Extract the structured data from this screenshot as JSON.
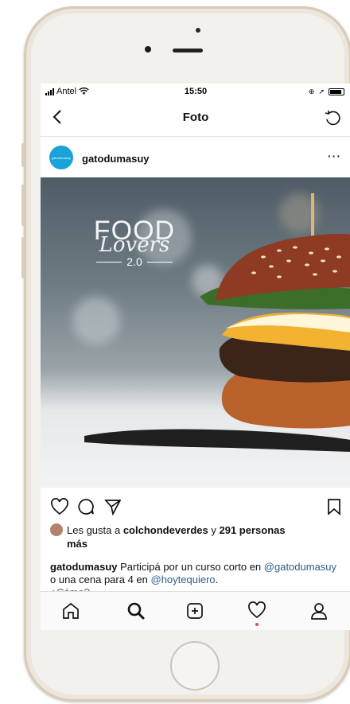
{
  "status_bar": {
    "carrier": "Antel",
    "time": "15:50"
  },
  "nav": {
    "title": "Foto"
  },
  "post": {
    "username": "gatodumasuy",
    "avatar_text": "gatodumasuy",
    "overlay": {
      "word": "FOOD",
      "script": "Lovers",
      "version": "2.0"
    },
    "likes": {
      "prefix": "Les gusta a ",
      "user": "colchondeverdes",
      "joiner": " y ",
      "count": "291 personas",
      "suffix": "más"
    },
    "caption": {
      "user": "gatodumasuy",
      "text1": " Participá por un curso corto en ",
      "mention1": "@gatodumasuy",
      "text2": " o una cena para 4 en ",
      "mention2": "@hoytequiero",
      "text3": ".",
      "more": "¿Cómo?"
    }
  },
  "icons": {
    "nav": [
      "back-arrow-icon",
      "refresh-icon"
    ],
    "actions": [
      "heart-icon",
      "comment-icon",
      "share-icon",
      "bookmark-icon"
    ],
    "tabs": [
      "home-icon",
      "search-icon",
      "add-post-icon",
      "activity-icon",
      "profile-icon"
    ]
  },
  "colors": {
    "mention": "#2f5d8a",
    "avatar": "#1aa3d9",
    "notification": "#ed4956"
  }
}
